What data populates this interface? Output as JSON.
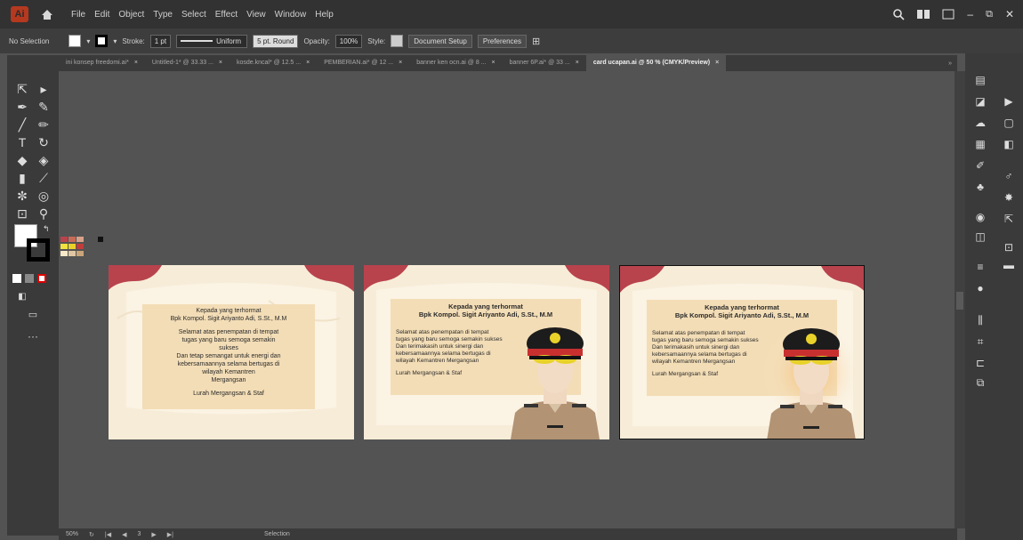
{
  "menubar": {
    "items": [
      "File",
      "Edit",
      "Object",
      "Type",
      "Select",
      "Effect",
      "View",
      "Window",
      "Help"
    ]
  },
  "control_bar": {
    "selection": "No Selection",
    "stroke_label": "Stroke:",
    "stroke_value": "1 pt",
    "stroke_style": "Uniform",
    "brush": "5 pt. Round",
    "opacity_label": "Opacity:",
    "opacity_value": "100%",
    "style_label": "Style:",
    "document_setup": "Document Setup",
    "preferences": "Preferences"
  },
  "tabs": [
    {
      "label": "ini konsep freedomi.ai*",
      "active": false
    },
    {
      "label": "Untitled-1* @ 33.33 ...",
      "active": false
    },
    {
      "label": "kosde.kncal* @ 12.5 ...",
      "active": false
    },
    {
      "label": "PEMBERIAN.ai* @ 12 ...",
      "active": false
    },
    {
      "label": "banner ken ocn.ai @ 8 ...",
      "active": false
    },
    {
      "label": "banner 6P.ai* @ 33 ...",
      "active": false
    },
    {
      "label": "card ucapan.ai @ 50 % (CMYK/Preview)",
      "active": true
    }
  ],
  "artboards": [
    {
      "lines": [
        "Kepada yang terhormat",
        "Bpk Kompol. Sigit Ariyanto Adi, S.St., M.M",
        "",
        "Selamat atas penempatan di tempat",
        "tugas yang baru semoga semakin",
        "sukses",
        "Dan tetap semangat untuk energi dan",
        "kebersamaannya selama bertugas di",
        "wilayah Kemantren",
        "Mergangsan",
        "",
        "Lurah Mergangsan & Staf"
      ]
    },
    {
      "header": [
        "Kepada yang terhormat",
        "Bpk Kompol. Sigit Ariyanto Adi, S.St., M.M"
      ],
      "body": [
        "Selamat atas penempatan di tempat",
        "tugas yang baru semoga semakin sukses",
        "Dan terimakasih untuk sinergi dan",
        "kebersamaannya selama bertugas di",
        "wilayah Kemantren Mergangsan",
        "",
        "Lurah Mergangsan & Staf"
      ]
    },
    {
      "header": [
        "Kepada yang terhormat",
        "Bpk Kompol. Sigit Ariyanto Adi, S.St., M.M"
      ],
      "body": [
        "Selamat atas penempatan di tempat",
        "tugas yang baru semoga semakin sukses",
        "Dan terimakasih untuk sinergi dan",
        "kebersamaannya selama bertugas di",
        "wilayah Kemantren Mergangsan",
        "",
        "Lurah Mergangsan & Staf"
      ]
    }
  ],
  "status": {
    "zoom": "50%",
    "artboard_number": "3",
    "tool": "Selection"
  },
  "colors": {
    "maroon": "#b8434d",
    "cream": "#f7ecd8",
    "panel": "#f3ddb6",
    "uniform": "#b29373",
    "cap": "#1c1c1c",
    "gold": "#e8d22a"
  }
}
